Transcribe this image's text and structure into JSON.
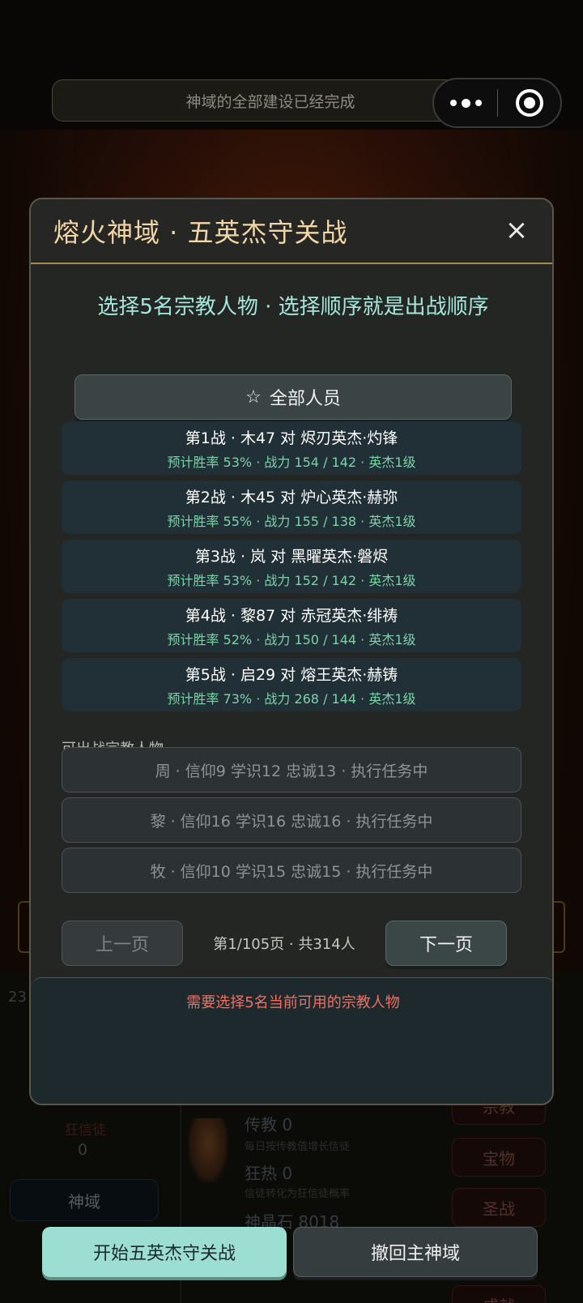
{
  "notice": "神域的全部建设已经完成",
  "modal": {
    "title": "熔火神域 · 五英杰守关战",
    "close": "×",
    "subtitle": "选择5名宗教人物 · 选择顺序就是出战顺序",
    "filter_icon": "☆",
    "filter_label": "全部人员",
    "battles": [
      {
        "title": "第1战 · 木47  对  烬刃英杰·灼锋",
        "detail": "预计胜率 53% · 战力 154 / 142 · 英杰1级"
      },
      {
        "title": "第2战 · 木45  对  炉心英杰·赫弥",
        "detail": "预计胜率 55% · 战力 155 / 138 · 英杰1级"
      },
      {
        "title": "第3战 · 岚  对  黑曜英杰·磐烬",
        "detail": "预计胜率 53% · 战力 152 / 142 · 英杰1级"
      },
      {
        "title": "第4战 · 黎87  对  赤冠英杰·绯祷",
        "detail": "预计胜率 52% · 战力 150 / 144 · 英杰1级"
      },
      {
        "title": "第5战 · 启29  对  熔王英杰·赫铸",
        "detail": "预计胜率 73% · 战力 268 / 144 · 英杰1级"
      }
    ],
    "available_label": "可出战宗教人物",
    "available": [
      "周 · 信仰9 学识12 忠诚13 · 执行任务中",
      "黎 · 信仰16 学识16 忠诚16 · 执行任务中",
      "牧 · 信仰10 学识15 忠诚15 · 执行任务中"
    ],
    "prev_page": "上一页",
    "page_info": "第1/105页 · 共314人",
    "next_page": "下一页",
    "warning": "需要选择5名当前可用的宗教人物"
  },
  "background": {
    "number": "23",
    "zealot_label": "狂信徒",
    "zealot_value": "0",
    "domain_button": "神域",
    "stats": [
      {
        "label": "传教 0",
        "desc": "每日按传教值增长信徒"
      },
      {
        "label": "狂热 0",
        "desc": "信徒转化为狂信徒概率"
      },
      {
        "label": "神晶石 8018",
        "desc": ""
      }
    ],
    "right_buttons": [
      "宗教",
      "宝物",
      "圣战",
      "成就"
    ]
  },
  "actions": {
    "start": "开始五英杰守关战",
    "recall": "撤回主神域"
  },
  "colors": {
    "accent_title": "#f1d7a6",
    "subtitle": "#a5e7dc",
    "win_rate": "#7ad3a8",
    "warning": "#f26f62",
    "primary_button": "#9cdfd2"
  }
}
